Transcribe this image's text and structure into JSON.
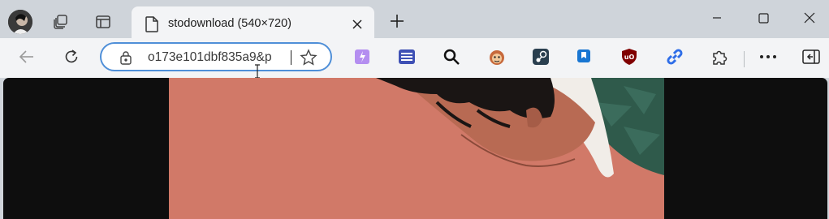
{
  "tab": {
    "title": "stodownload (540×720)"
  },
  "address_bar": {
    "url": "o173e101dbf835a9&p"
  },
  "extensions": {
    "badge_count": "9"
  },
  "colors": {
    "accent": "#4f8fd8",
    "photo_background": "#d17968"
  },
  "icons": [
    "profile-avatar",
    "workspaces-icon",
    "tab-actions-icon",
    "document-icon",
    "close-icon",
    "new-tab-icon",
    "minimize-icon",
    "maximize-icon",
    "window-close-icon",
    "back-icon",
    "refresh-icon",
    "lock-icon",
    "favorite-star-icon",
    "extension-icons",
    "extensions-puzzle-icon",
    "more-menu-icon",
    "sidebar-toggle-icon"
  ]
}
